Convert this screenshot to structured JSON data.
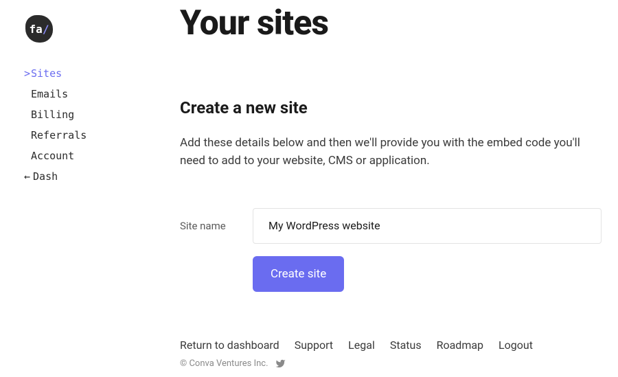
{
  "logo": {
    "text": "fa",
    "slash": "/"
  },
  "nav": {
    "items": [
      {
        "label": "Sites",
        "active": true
      },
      {
        "label": "Emails"
      },
      {
        "label": "Billing"
      },
      {
        "label": "Referrals"
      },
      {
        "label": "Account"
      }
    ],
    "back": {
      "label": "Dash",
      "arrow": "←"
    },
    "caret": ">"
  },
  "page": {
    "title": "Your sites",
    "section_title": "Create a new site",
    "section_desc": "Add these details below and then we'll provide you with the embed code you'll need to add to your website, CMS or application.",
    "field_label": "Site name",
    "site_name_value": "My WordPress website",
    "create_button": "Create site"
  },
  "footer": {
    "links": [
      "Return to dashboard",
      "Support",
      "Legal",
      "Status",
      "Roadmap",
      "Logout"
    ],
    "copyright": "© Conva Ventures Inc."
  },
  "colors": {
    "accent": "#6a6cf0"
  }
}
